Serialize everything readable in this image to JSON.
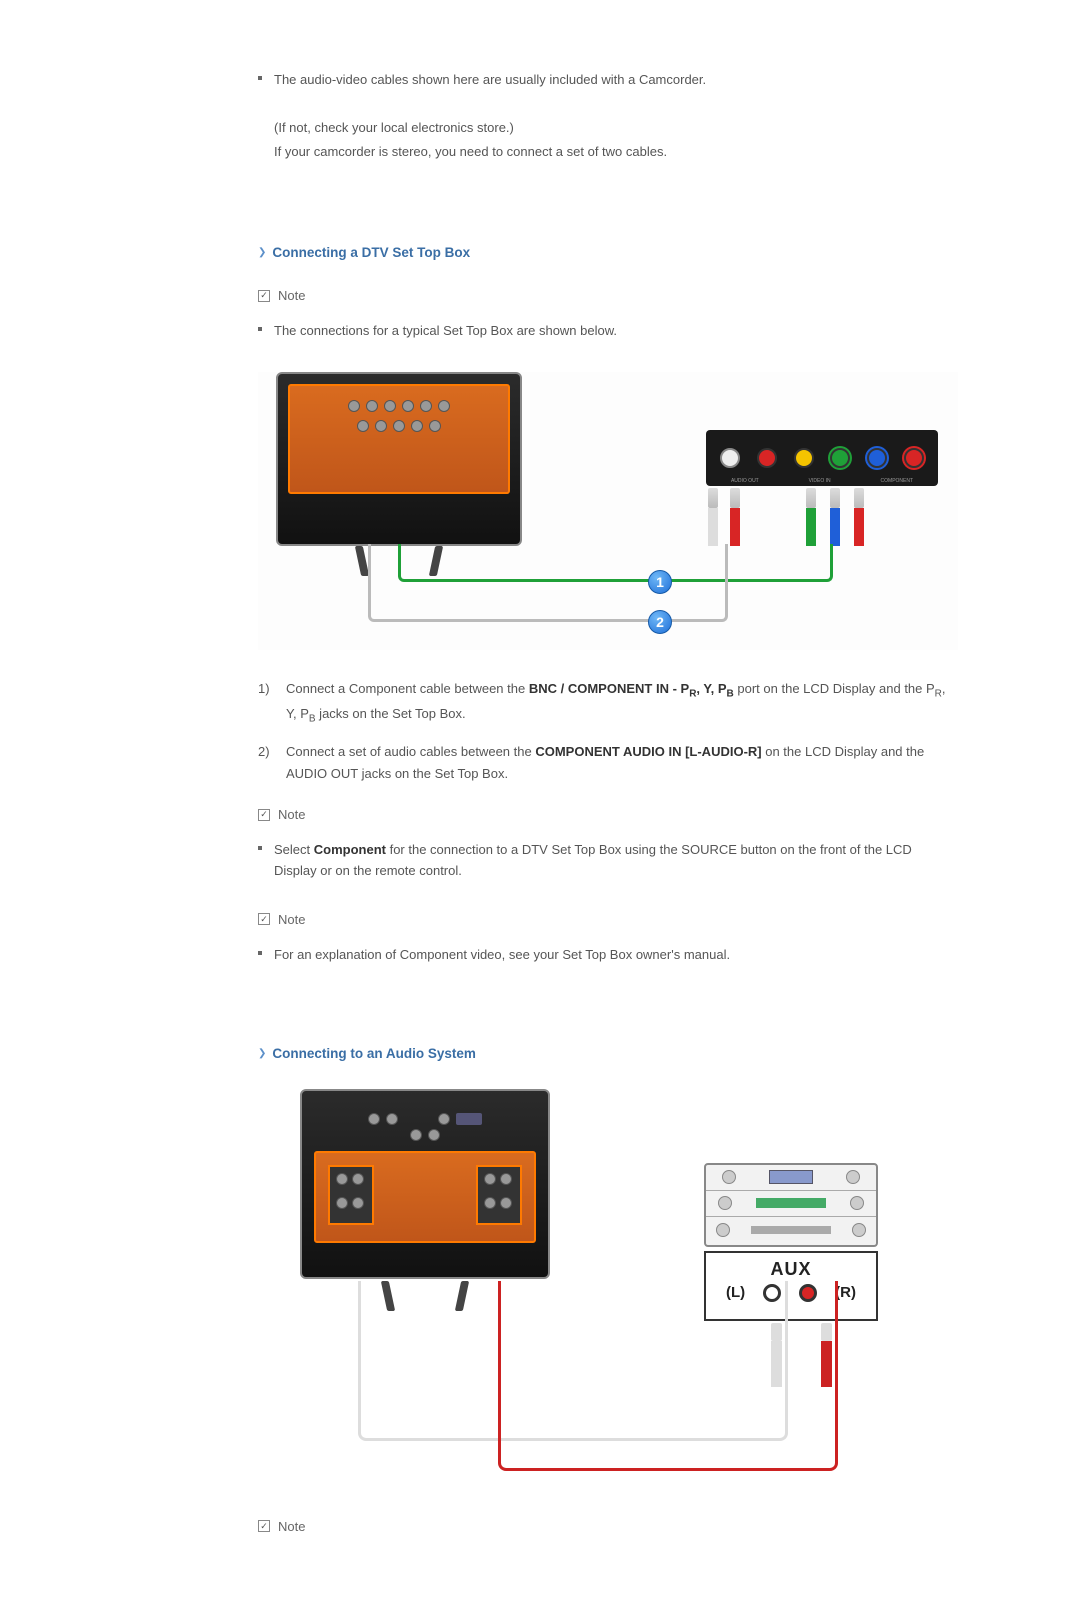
{
  "intro": {
    "bullet": "The audio-video cables shown here are usually included with a Camcorder.",
    "line1": "(If not, check your local electronics store.)",
    "line2": "If your camcorder is stereo, you need to connect a set of two cables."
  },
  "section1": {
    "title": "Connecting a DTV Set Top Box",
    "note1_label": "Note",
    "bullet1": "The connections for a typical Set Top Box are shown below.",
    "diagram": {
      "badge1": "1",
      "badge2": "2",
      "panel_label_audio": "AUDIO OUT",
      "panel_label_video": "VIDEO IN",
      "panel_label_component": "COMPONENT"
    },
    "step1_num": "1)",
    "step1_pre": "Connect a Component cable between the ",
    "step1_bold": "BNC / COMPONENT IN - P",
    "step1_sub_r": "R",
    "step1_mid": ", Y, P",
    "step1_sub_b": "B",
    "step1_post": " port on the LCD Display and the P",
    "step1_sub_r2": "R",
    "step1_mid2": ", Y, P",
    "step1_sub_b2": "B",
    "step1_end": " jacks on the Set Top Box.",
    "step2_num": "2)",
    "step2_pre": "Connect a set of audio cables between the ",
    "step2_bold": "COMPONENT AUDIO IN [L-AUDIO-R]",
    "step2_post": " on the LCD Display and the AUDIO OUT jacks on the Set Top Box.",
    "note2_label": "Note",
    "bullet2_pre": "Select ",
    "bullet2_bold": "Component",
    "bullet2_post": " for the connection to a DTV Set Top Box using the SOURCE button on the front of the LCD Display or on the remote control.",
    "note3_label": "Note",
    "bullet3": "For an explanation of Component video, see your Set Top Box owner's manual."
  },
  "section2": {
    "title": "Connecting to an Audio System",
    "diagram": {
      "aux": "AUX",
      "l": "(L)",
      "r": "(R)"
    },
    "note_label": "Note"
  }
}
